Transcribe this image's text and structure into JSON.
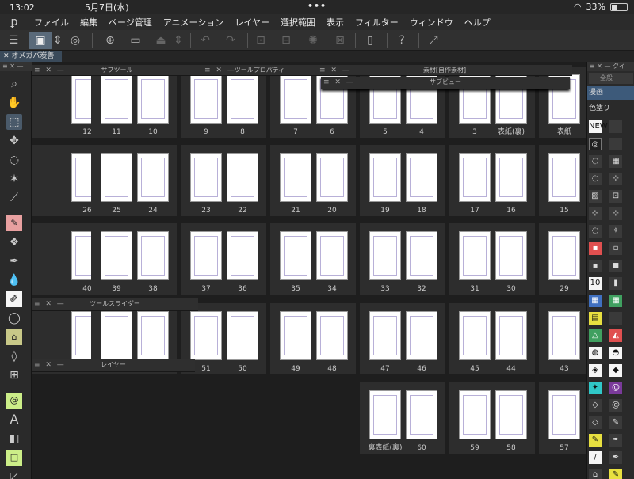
{
  "status": {
    "time": "13:02",
    "date": "5月7日(水)",
    "battery": "33%",
    "battery_level": 0.33
  },
  "menu": [
    "ファイル",
    "編集",
    "ページ管理",
    "アニメーション",
    "レイヤー",
    "選択範囲",
    "表示",
    "フィルター",
    "ウィンドウ",
    "ヘルプ"
  ],
  "document_tab": "オメガバ炭善",
  "panels": {
    "subtool": "サブツール",
    "tool_property": "ツールプロパティ",
    "material": "素材[自作素材]",
    "sub_view": "サブビュー",
    "tool_slider": "ツールスライダー",
    "layer": "レイヤー",
    "right_header": "クイ",
    "right_search": "全般"
  },
  "right_categories": [
    "漫画",
    "色塗り"
  ],
  "rows": [
    [
      "12",
      "11",
      "10",
      "9",
      "8",
      "7",
      "6",
      "5",
      "4",
      "3",
      "表紙(裏)",
      "表紙"
    ],
    [
      "26",
      "25",
      "24",
      "23",
      "22",
      "21",
      "20",
      "19",
      "18",
      "17",
      "16",
      "15"
    ],
    [
      "40",
      "39",
      "38",
      "37",
      "36",
      "35",
      "34",
      "33",
      "32",
      "31",
      "30",
      "29"
    ],
    [
      "",
      "",
      "",
      "51",
      "50",
      "49",
      "48",
      "47",
      "46",
      "45",
      "44",
      "43"
    ],
    [
      "",
      "",
      "",
      "",
      "",
      "",
      "",
      "裏表紙(裏)",
      "60",
      "59",
      "58",
      "57"
    ]
  ],
  "icons": {
    "toolbar": [
      "menu-icon",
      "canvas-icon",
      "new-page-icon",
      "open-icon",
      "save-icon",
      "undo-icon",
      "redo-icon",
      "help-icon",
      "fullscreen-icon"
    ],
    "left_tools": [
      "zoom-icon",
      "hand-icon",
      "operation-icon",
      "move-icon",
      "lasso-icon",
      "magic-wand-icon",
      "eyedropper-icon",
      "pen-icon",
      "pattern-icon",
      "brush-icon",
      "fill-icon",
      "vector-icon",
      "ring-icon",
      "text-icon",
      "gradient-icon"
    ]
  }
}
